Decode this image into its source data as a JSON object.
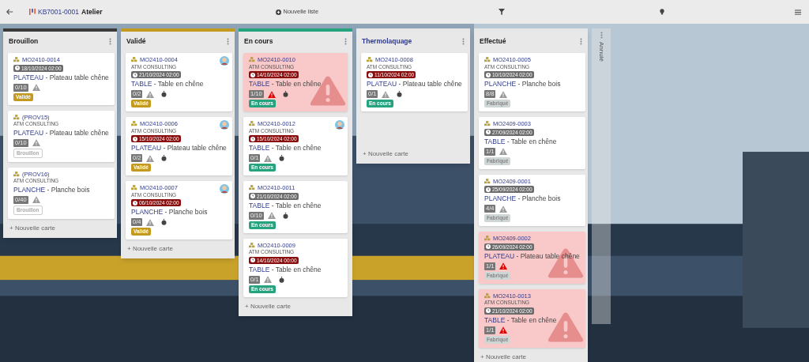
{
  "topbar": {
    "board_ref": "KB7001-0001",
    "board_name": "Atelier",
    "new_list": "Nouvelle liste"
  },
  "columns": [
    {
      "title": "Brouillon",
      "color": "#3a3a3a",
      "add_card": "+ Nouvelle carte",
      "cards": [
        {
          "ref": "MO2410-0014",
          "date": "18/10/2024 02:00",
          "overdue": false,
          "code": "PLATEAU",
          "separator": "-",
          "label": "Plateau table chêne",
          "qty": "0/10",
          "warning": false,
          "timer": false,
          "avatar": false,
          "alert": false,
          "status": {
            "label": "Validé",
            "kind": "validated"
          }
        },
        {
          "ref": "(PROV15)",
          "company": "ATM CONSULTING",
          "code": "PLATEAU",
          "separator": "-",
          "label": "Plateau table chêne",
          "qty": "0/10",
          "warning": false,
          "timer": false,
          "avatar": false,
          "alert": false,
          "status": {
            "label": "Brouillon",
            "kind": "draft"
          }
        },
        {
          "ref": "(PROV16)",
          "company": "ATM CONSULTING",
          "code": "PLANCHE",
          "separator": "-",
          "label": "Planche bois",
          "qty": "0/40",
          "warning": false,
          "timer": false,
          "avatar": false,
          "alert": false,
          "status": {
            "label": "Brouillon",
            "kind": "draft"
          }
        }
      ]
    },
    {
      "title": "Validé",
      "color": "#c49a1e",
      "add_card": "+ Nouvelle carte",
      "cards": [
        {
          "ref": "MO2410-0004",
          "company": "ATM CONSULTING",
          "date": "21/10/2024 02:00",
          "overdue": false,
          "code": "TABLE",
          "separator": "-",
          "label": "Table en chêne",
          "qty": "0/2",
          "warning": false,
          "timer": true,
          "avatar": true,
          "alert": false,
          "status": {
            "label": "Validé",
            "kind": "validated"
          }
        },
        {
          "ref": "MO2410-0006",
          "company": "ATM CONSULTING",
          "date": "15/10/2024 02:00",
          "overdue": true,
          "code": "PLATEAU",
          "separator": "-",
          "label": "Plateau table chêne",
          "qty": "0/2",
          "warning": false,
          "timer": true,
          "avatar": true,
          "alert": false,
          "status": {
            "label": "Validé",
            "kind": "validated"
          }
        },
        {
          "ref": "MO2410-0007",
          "company": "ATM CONSULTING",
          "date": "06/10/2024 02:00",
          "overdue": true,
          "code": "PLANCHE",
          "separator": "-",
          "label": "Planche bois",
          "qty": "0/4",
          "warning": false,
          "timer": true,
          "avatar": true,
          "alert": false,
          "status": {
            "label": "Validé",
            "kind": "validated"
          }
        }
      ]
    },
    {
      "title": "En cours",
      "color": "#25a37f",
      "add_card": "+ Nouvelle carte",
      "cards": [
        {
          "ref": "MO2410-0010",
          "company": "ATM CONSULTING",
          "date": "14/10/2024 02:00",
          "overdue": true,
          "code": "TABLE",
          "separator": "-",
          "label": "Table en chêne",
          "qty": "1/10",
          "warning": true,
          "timer": true,
          "avatar": false,
          "alert": true,
          "status": {
            "label": "En cours",
            "kind": "in_progress"
          }
        },
        {
          "ref": "MO2410-0012",
          "company": "ATM CONSULTING",
          "date": "15/10/2024 02:00",
          "overdue": true,
          "code": "TABLE",
          "separator": "-",
          "label": "Table en chêne",
          "qty": "0/1",
          "warning": false,
          "timer": true,
          "avatar": true,
          "alert": false,
          "status": {
            "label": "En cours",
            "kind": "in_progress"
          }
        },
        {
          "ref": "MO2410-0011",
          "date": "21/10/2024 02:00",
          "overdue": false,
          "code": "TABLE",
          "separator": "-",
          "label": "Table en chêne",
          "qty": "0/10",
          "warning": false,
          "timer": true,
          "avatar": false,
          "alert": false,
          "status": {
            "label": "En cours",
            "kind": "in_progress"
          }
        },
        {
          "ref": "MO2410-0009",
          "company": "ATM CONSULTING",
          "date": "14/10/2024 00:00",
          "overdue": true,
          "code": "TABLE",
          "separator": "-",
          "label": "Table en chêne",
          "qty": "0/1",
          "warning": false,
          "timer": true,
          "avatar": false,
          "alert": false,
          "status": {
            "label": "En cours",
            "kind": "in_progress"
          }
        }
      ]
    },
    {
      "title": "Thermolaquage",
      "color": "#e6e6e6",
      "add_card": "+ Nouvelle carte",
      "cards": [
        {
          "ref": "MO2410-0008",
          "company": "ATM CONSULTING",
          "date": "11/10/2024 02:00",
          "overdue": true,
          "code": "PLATEAU",
          "separator": "-",
          "label": "Plateau table chêne",
          "qty": "0/1",
          "warning": false,
          "timer": true,
          "avatar": false,
          "alert": false,
          "status": {
            "label": "En cours",
            "kind": "in_progress"
          }
        }
      ]
    },
    {
      "title": "Effectué",
      "color": "#e6e6e6",
      "add_card": "+ Nouvelle carte",
      "cards": [
        {
          "ref": "MO2410-0005",
          "company": "ATM CONSULTING",
          "date": "10/10/2024 02:00",
          "overdue": false,
          "code": "PLANCHE",
          "separator": "-",
          "label": "Planche bois",
          "qty": "8/8",
          "warning": false,
          "timer": false,
          "avatar": false,
          "alert": false,
          "status": {
            "label": "Fabriqué",
            "kind": "made"
          }
        },
        {
          "ref": "MO2409-0003",
          "date": "27/09/2024 02:00",
          "overdue": false,
          "code": "TABLE",
          "separator": "-",
          "label": "Table en chêne",
          "qty": "1/1",
          "warning": false,
          "timer": false,
          "avatar": false,
          "alert": false,
          "status": {
            "label": "Fabriqué",
            "kind": "made"
          }
        },
        {
          "ref": "MO2409-0001",
          "date": "25/09/2024 02:00",
          "overdue": false,
          "code": "PLANCHE",
          "separator": "-",
          "label": "Planche bois",
          "qty": "4/4",
          "warning": false,
          "timer": false,
          "avatar": false,
          "alert": false,
          "status": {
            "label": "Fabriqué",
            "kind": "made"
          }
        },
        {
          "ref": "MO2409-0002",
          "date": "26/09/2024 02:00",
          "overdue": false,
          "code": "PLATEAU",
          "separator": "-",
          "label": "Plateau table chêne",
          "qty": "1/1",
          "warning": true,
          "timer": false,
          "avatar": false,
          "alert": true,
          "status": {
            "label": "Fabriqué",
            "kind": "made"
          }
        },
        {
          "ref": "MO2410-0013",
          "company": "ATM CONSULTING",
          "date": "21/10/2024 02:00",
          "overdue": false,
          "code": "TABLE",
          "separator": "-",
          "label": "Table en chêne",
          "qty": "1/1",
          "warning": true,
          "timer": false,
          "avatar": false,
          "alert": true,
          "status": {
            "label": "Fabriqué",
            "kind": "made"
          }
        }
      ]
    }
  ],
  "collapsed_column": {
    "title": "Annulé"
  }
}
